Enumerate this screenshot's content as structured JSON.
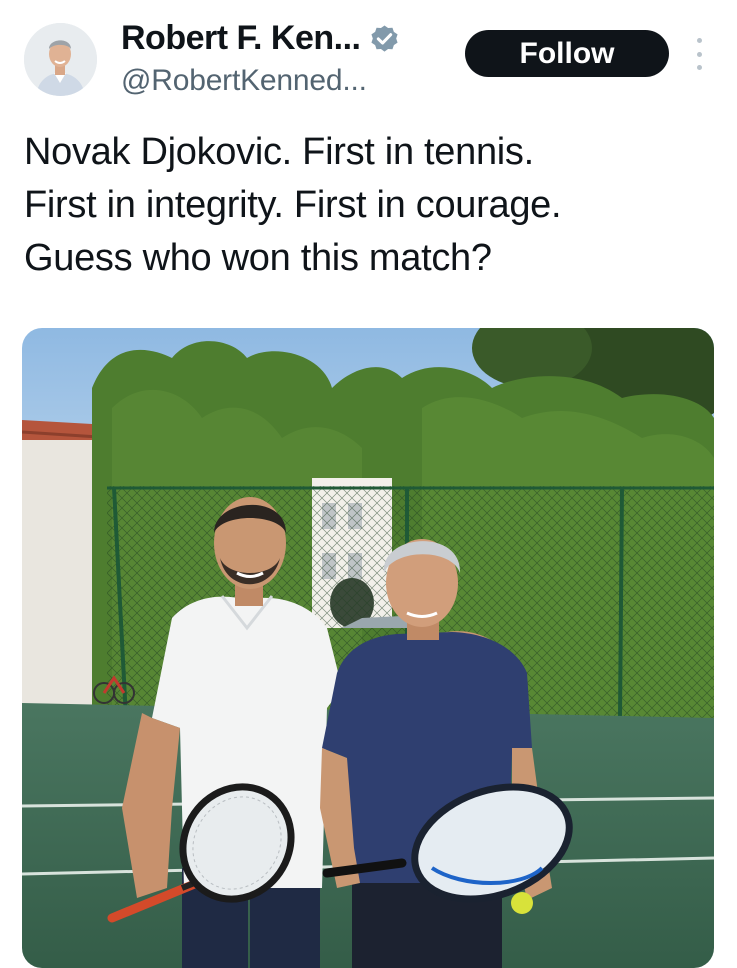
{
  "author": {
    "display_name": "Robert F. Ken...",
    "handle": "@RobertKenned...",
    "verified": true,
    "avatar_icon": "profile-photo"
  },
  "actions": {
    "follow_label": "Follow",
    "more_icon": "more-vertical-icon"
  },
  "tweet": {
    "lines": [
      "Novak Djokovic. First in tennis.",
      "First in integrity. First in courage.",
      "Guess who won this match?"
    ]
  },
  "media": {
    "type": "photo",
    "icon": "photo-two-men-tennis-court"
  },
  "colors": {
    "follow_bg": "#0f1419",
    "verified_badge": "#829aab",
    "handle_text": "#536471",
    "court_green": "#3f6b54",
    "hedge_green": "#4b7a2e",
    "sky": "#a9cbe8"
  }
}
